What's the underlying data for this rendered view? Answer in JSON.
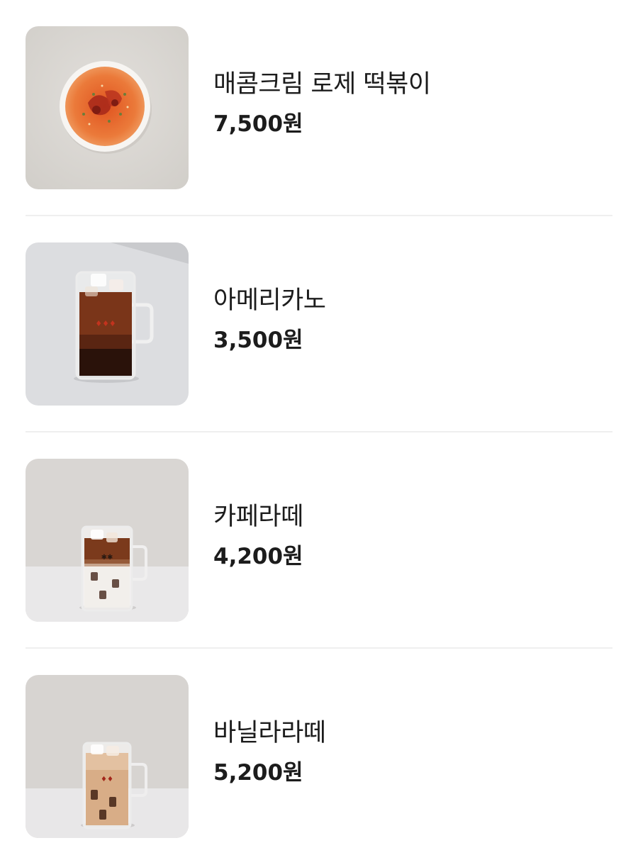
{
  "menu": {
    "items": [
      {
        "name": "매콤크림 로제 떡볶이",
        "price": "7,500원",
        "image_icon": "rose-tteokbokki-photo"
      },
      {
        "name": "아메리카노",
        "price": "3,500원",
        "image_icon": "iced-americano-photo"
      },
      {
        "name": "카페라떼",
        "price": "4,200원",
        "image_icon": "iced-cafe-latte-photo"
      },
      {
        "name": "바닐라라떼",
        "price": "5,200원",
        "image_icon": "iced-vanilla-latte-photo"
      }
    ]
  },
  "colors": {
    "text": "#1c1c1c",
    "divider": "#efefef",
    "background": "#ffffff"
  }
}
